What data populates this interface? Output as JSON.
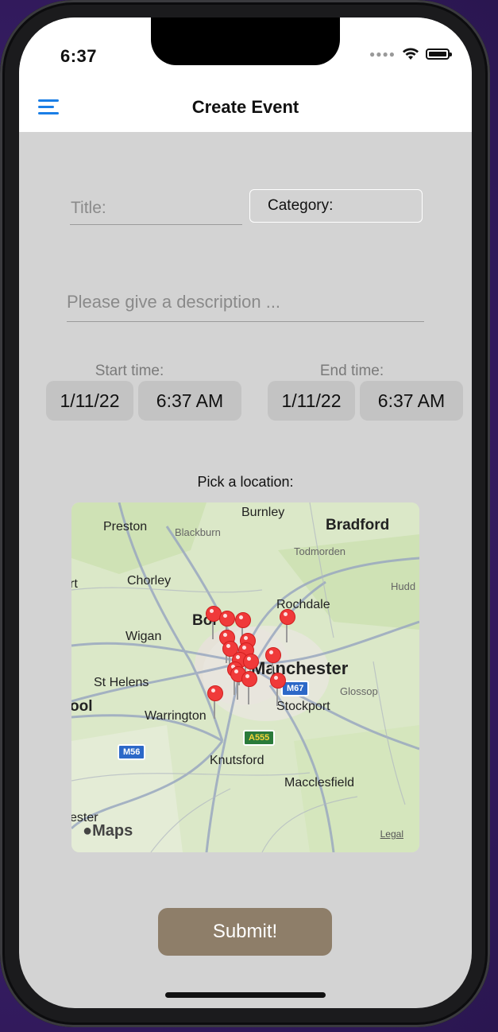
{
  "status_bar": {
    "time": "6:37",
    "signal_icon": "cellular-dots-icon",
    "wifi_icon": "wifi-icon",
    "battery_icon": "battery-icon"
  },
  "nav": {
    "menu_icon": "hamburger-menu-icon",
    "title": "Create Event",
    "accent_color": "#1a7ee6"
  },
  "form": {
    "title_placeholder": "Title:",
    "category_label": "Category:",
    "description_placeholder": "Please give a description ...",
    "start": {
      "label": "Start time:",
      "date": "1/11/22",
      "time": "6:37 AM"
    },
    "end": {
      "label": "End time:",
      "date": "1/11/22",
      "time": "6:37 AM"
    },
    "location_label": "Pick a location:",
    "submit_label": "Submit!"
  },
  "map": {
    "places": [
      "Burnley",
      "Preston",
      "Blackburn",
      "Bradford",
      "Todmorden",
      "Chorley",
      "Hudd",
      "Rochdale",
      "Bol",
      "Wigan",
      "Manchester",
      "St Helens",
      "Glossop",
      "ool",
      "Stockport",
      "Warrington",
      "Knutsford",
      "Macclesfield",
      "ester",
      "rt"
    ],
    "road_shields": [
      "M67",
      "A555",
      "M56"
    ],
    "logo": "Maps",
    "legal": "Legal",
    "pin_color": "#f03a3a"
  },
  "colors": {
    "background": "#d3d3d3",
    "submit": "#8e7e69"
  }
}
